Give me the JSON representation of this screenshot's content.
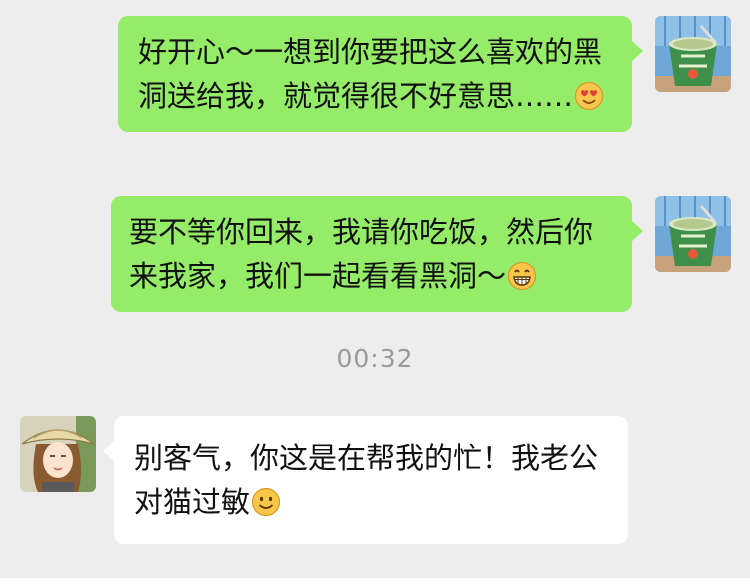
{
  "messages": [
    {
      "sender": "me",
      "text": "好开心～一想到你要把这么喜欢的黑洞送给我，就觉得很不好意思……",
      "emoji": "heart-eyes-emoji"
    },
    {
      "sender": "me",
      "text": "要不等你回来，我请你吃饭，然后你来我家，我们一起看看黑洞～",
      "emoji": "grinning-emoji"
    },
    {
      "sender": "them",
      "text": "别客气，你这是在帮我的忙！我老公对猫过敏",
      "emoji": "smiling-emoji"
    }
  ],
  "timestamp": "00:32",
  "colors": {
    "background": "#ededed",
    "own_bubble": "#95ec69",
    "other_bubble": "#ffffff",
    "timestamp_text": "#9a9a9a"
  },
  "icons": {
    "own_avatar": "noodle-cup-avatar",
    "other_avatar": "woman-straw-hat-avatar"
  }
}
